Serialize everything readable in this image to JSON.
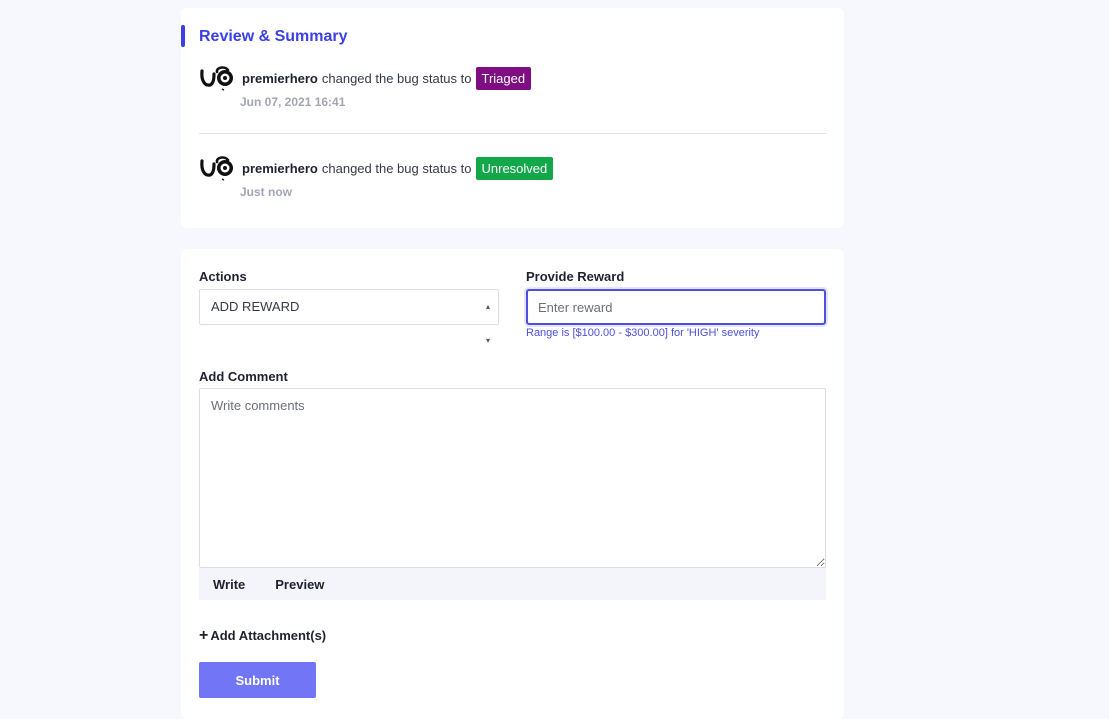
{
  "review": {
    "title": "Review & Summary",
    "activities": [
      {
        "user": "premierhero",
        "text": "changed the bug status to",
        "status": "Triaged",
        "status_color": "#7e0e82",
        "time": "Jun 07, 2021 16:41",
        "avatar_icon": "user-avatar-icon"
      },
      {
        "user": "premierhero",
        "text": "changed the bug status to",
        "status": "Unresolved",
        "status_color": "#12a84a",
        "time": "Just now",
        "avatar_icon": "user-avatar-icon"
      }
    ]
  },
  "actions": {
    "label": "Actions",
    "selected": "ADD REWARD"
  },
  "reward": {
    "label": "Provide Reward",
    "placeholder": "Enter reward",
    "hint": "Range is [$100.00 - $300.00] for 'HIGH' severity"
  },
  "comment": {
    "label": "Add Comment",
    "placeholder": "Write comments",
    "tabs": [
      "Write",
      "Preview"
    ]
  },
  "attachment": {
    "label": "Add Attachment(s)"
  },
  "submit": {
    "label": "Submit"
  },
  "colors": {
    "accent": "#3b3fe6",
    "submit": "#7275f5",
    "page_bg": "#f7f8fe"
  }
}
